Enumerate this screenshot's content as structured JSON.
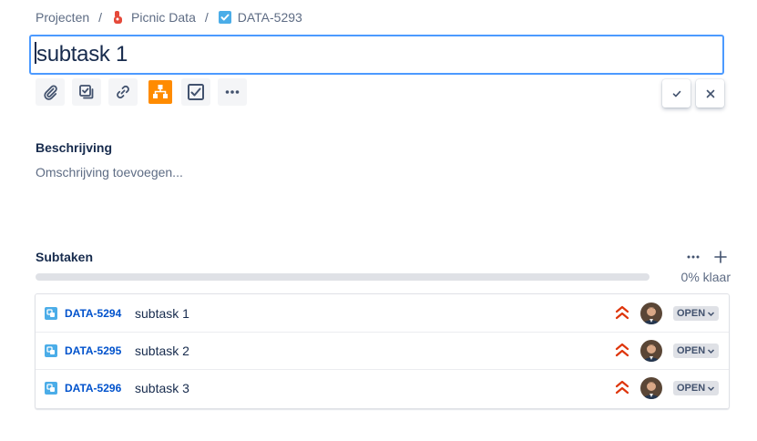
{
  "breadcrumb": {
    "projects": "Projecten",
    "project": "Picnic Data",
    "issue": "DATA-5293",
    "separator": "/"
  },
  "title": {
    "value": "subtask 1"
  },
  "toolbar": {
    "icons": [
      "paperclip-icon",
      "subtask-icon",
      "link-icon",
      "diagram-icon",
      "checklist-icon",
      "more-icon"
    ]
  },
  "confirm": {
    "save_icon": "check-icon",
    "cancel_icon": "close-icon"
  },
  "description": {
    "heading": "Beschrijving",
    "placeholder": "Omschrijving toevoegen..."
  },
  "subtasks": {
    "heading": "Subtaken",
    "progress_fraction": 0,
    "progress_label": "0% klaar",
    "items": [
      {
        "key": "DATA-5294",
        "summary": "subtask 1",
        "status": "OPEN"
      },
      {
        "key": "DATA-5295",
        "summary": "subtask 2",
        "status": "OPEN"
      },
      {
        "key": "DATA-5296",
        "summary": "subtask 3",
        "status": "OPEN"
      }
    ]
  },
  "colors": {
    "accent": "#4c9aff",
    "link": "#0052cc",
    "priority": "#de350b",
    "highlight_button": "#ff8b00"
  }
}
